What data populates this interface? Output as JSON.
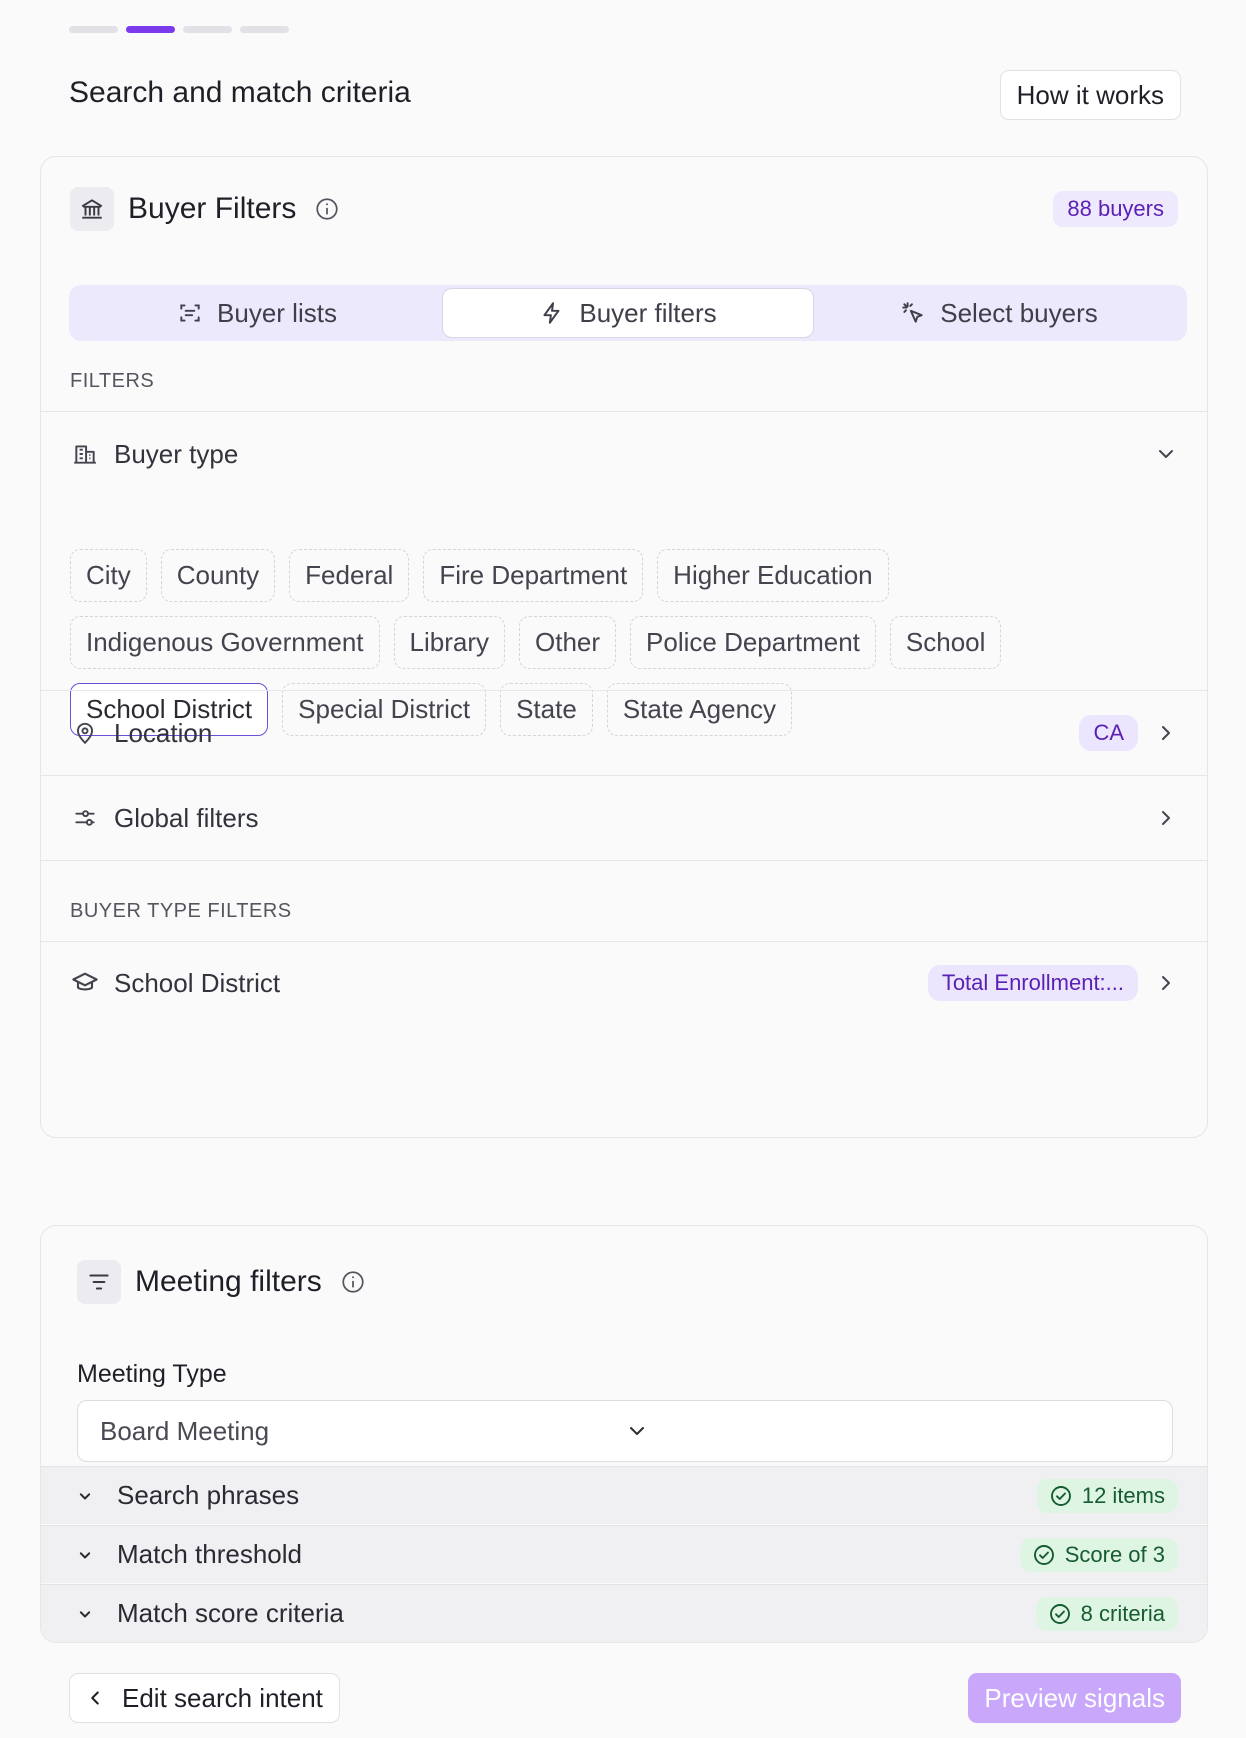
{
  "steps": {
    "total": 4,
    "active_index": 1
  },
  "header": {
    "title": "Search and match criteria",
    "how_it_works": "How it works"
  },
  "buyer_filters": {
    "title": "Buyer Filters",
    "count_badge": "88 buyers",
    "tabs": [
      {
        "label": "Buyer lists",
        "icon": "list-scan-icon",
        "active": false
      },
      {
        "label": "Buyer filters",
        "icon": "lightning-icon",
        "active": true
      },
      {
        "label": "Select buyers",
        "icon": "cursor-click-icon",
        "active": false
      }
    ],
    "filters_label": "FILTERS",
    "buyer_type": {
      "label": "Buyer type",
      "options": [
        {
          "label": "City",
          "selected": false
        },
        {
          "label": "County",
          "selected": false
        },
        {
          "label": "Federal",
          "selected": false
        },
        {
          "label": "Fire Department",
          "selected": false
        },
        {
          "label": "Higher Education",
          "selected": false
        },
        {
          "label": "Indigenous Government",
          "selected": false
        },
        {
          "label": "Library",
          "selected": false
        },
        {
          "label": "Other",
          "selected": false
        },
        {
          "label": "Police Department",
          "selected": false
        },
        {
          "label": "School",
          "selected": false
        },
        {
          "label": "School District",
          "selected": true
        },
        {
          "label": "Special District",
          "selected": false
        },
        {
          "label": "State",
          "selected": false
        },
        {
          "label": "State Agency",
          "selected": false
        }
      ]
    },
    "location": {
      "label": "Location",
      "value": "CA"
    },
    "global_filters": {
      "label": "Global filters"
    },
    "buyer_type_filters_label": "BUYER TYPE FILTERS",
    "school_district": {
      "label": "School District",
      "value": "Total Enrollment:..."
    }
  },
  "meeting_filters": {
    "title": "Meeting filters",
    "meeting_type_label": "Meeting Type",
    "meeting_type_value": "Board Meeting",
    "sections": [
      {
        "label": "Search phrases",
        "badge": "12 items"
      },
      {
        "label": "Match threshold",
        "badge": "Score of 3"
      },
      {
        "label": "Match score criteria",
        "badge": "8 criteria"
      }
    ]
  },
  "footer": {
    "edit_label": "Edit search intent",
    "preview_label": "Preview signals"
  },
  "colors": {
    "accent": "#7c3aed",
    "accent_light": "#ebe6fd",
    "success_bg": "#dff5e4",
    "preview_disabled": "#c9a8fb"
  }
}
